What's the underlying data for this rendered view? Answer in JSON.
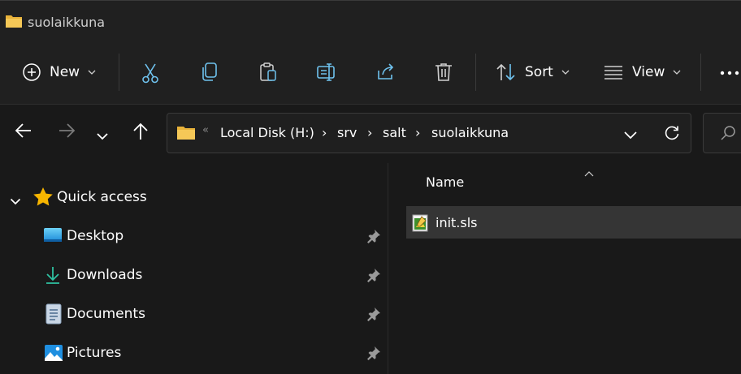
{
  "window": {
    "title": "suolaikkuna"
  },
  "toolbar": {
    "new_label": "New",
    "sort_label": "Sort",
    "view_label": "View",
    "icons": [
      "plus-circle-icon",
      "cut-icon",
      "copy-icon",
      "paste-icon",
      "rename-icon",
      "share-icon",
      "delete-icon",
      "sort-icon",
      "view-icon",
      "more-icon"
    ]
  },
  "navigation": {
    "breadcrumb_overflow": "«",
    "crumbs": [
      "Local Disk (H:)",
      "srv",
      "salt",
      "suolaikkuna"
    ],
    "separator": "›"
  },
  "sidebar": {
    "quick_access": "Quick access",
    "items": [
      {
        "label": "Desktop",
        "icon": "desktop-icon"
      },
      {
        "label": "Downloads",
        "icon": "downloads-icon"
      },
      {
        "label": "Documents",
        "icon": "documents-icon"
      },
      {
        "label": "Pictures",
        "icon": "pictures-icon"
      }
    ]
  },
  "content": {
    "column_name": "Name",
    "files": [
      {
        "name": "init.sls",
        "icon": "sls-file-icon"
      }
    ]
  },
  "colors": {
    "background": "#191919",
    "toolbar": "#202020",
    "folder": "#f5c143",
    "selection": "#353535"
  }
}
